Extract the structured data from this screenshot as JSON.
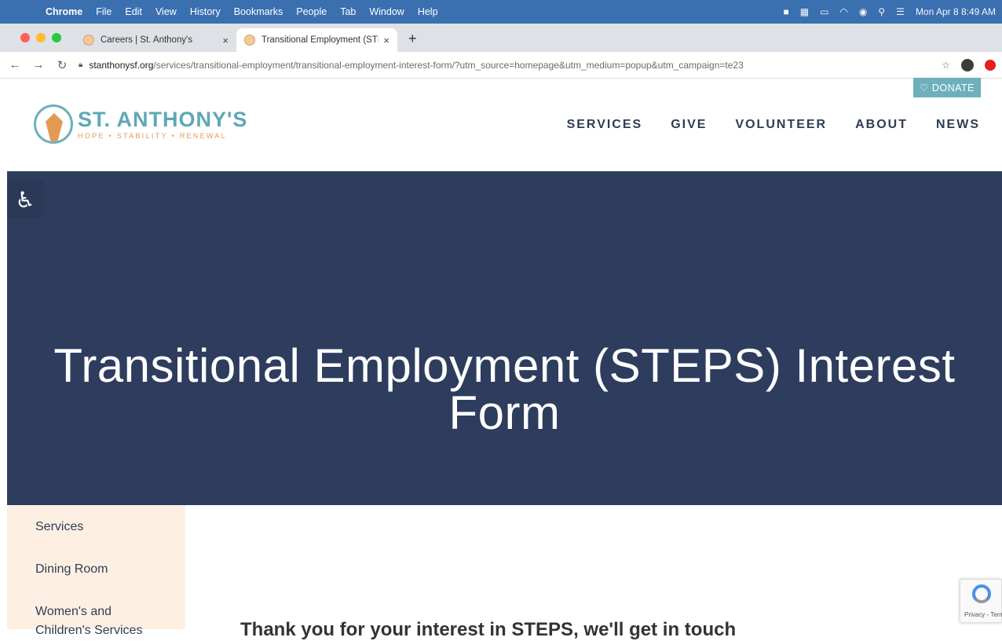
{
  "menubar": {
    "app": "Chrome",
    "items": [
      "File",
      "Edit",
      "View",
      "History",
      "Bookmarks",
      "People",
      "Tab",
      "Window",
      "Help"
    ],
    "clock": "Mon Apr 8  8:49 AM"
  },
  "tabs": [
    {
      "title": "Careers | St. Anthony's",
      "close": "×"
    },
    {
      "title": "Transitional Employment (STEPS) Interest Form",
      "close": "×"
    }
  ],
  "newtab": "+",
  "address": {
    "host": "stanthonysf.org",
    "path": "/services/transitional-employment/transitional-employment-interest-form/?utm_source=homepage&utm_medium=popup&utm_campaign=te23"
  },
  "site": {
    "donate": "♡ DONATE",
    "logo_name": "ST. ANTHONY'S",
    "logo_tag": "HOPE • STABILITY • RENEWAL",
    "nav": [
      "SERVICES",
      "GIVE",
      "VOLUNTEER",
      "ABOUT",
      "NEWS"
    ]
  },
  "hero": {
    "title_line1": "Transitional Employment (STEPS) Interest",
    "title_line2": "Form"
  },
  "subnav": [
    "Services",
    "Dining Room",
    "Women's and",
    "Children's Services"
  ],
  "content_heading": "Thank you for your interest in STEPS, we'll get in touch",
  "recaptcha_text": "Privacy - Terms",
  "colors": {
    "hero_bg": "#2e3d5e",
    "accent_teal": "#6db0bc",
    "accent_orange": "#e39a54",
    "subnav_bg": "#fdf0e3"
  }
}
